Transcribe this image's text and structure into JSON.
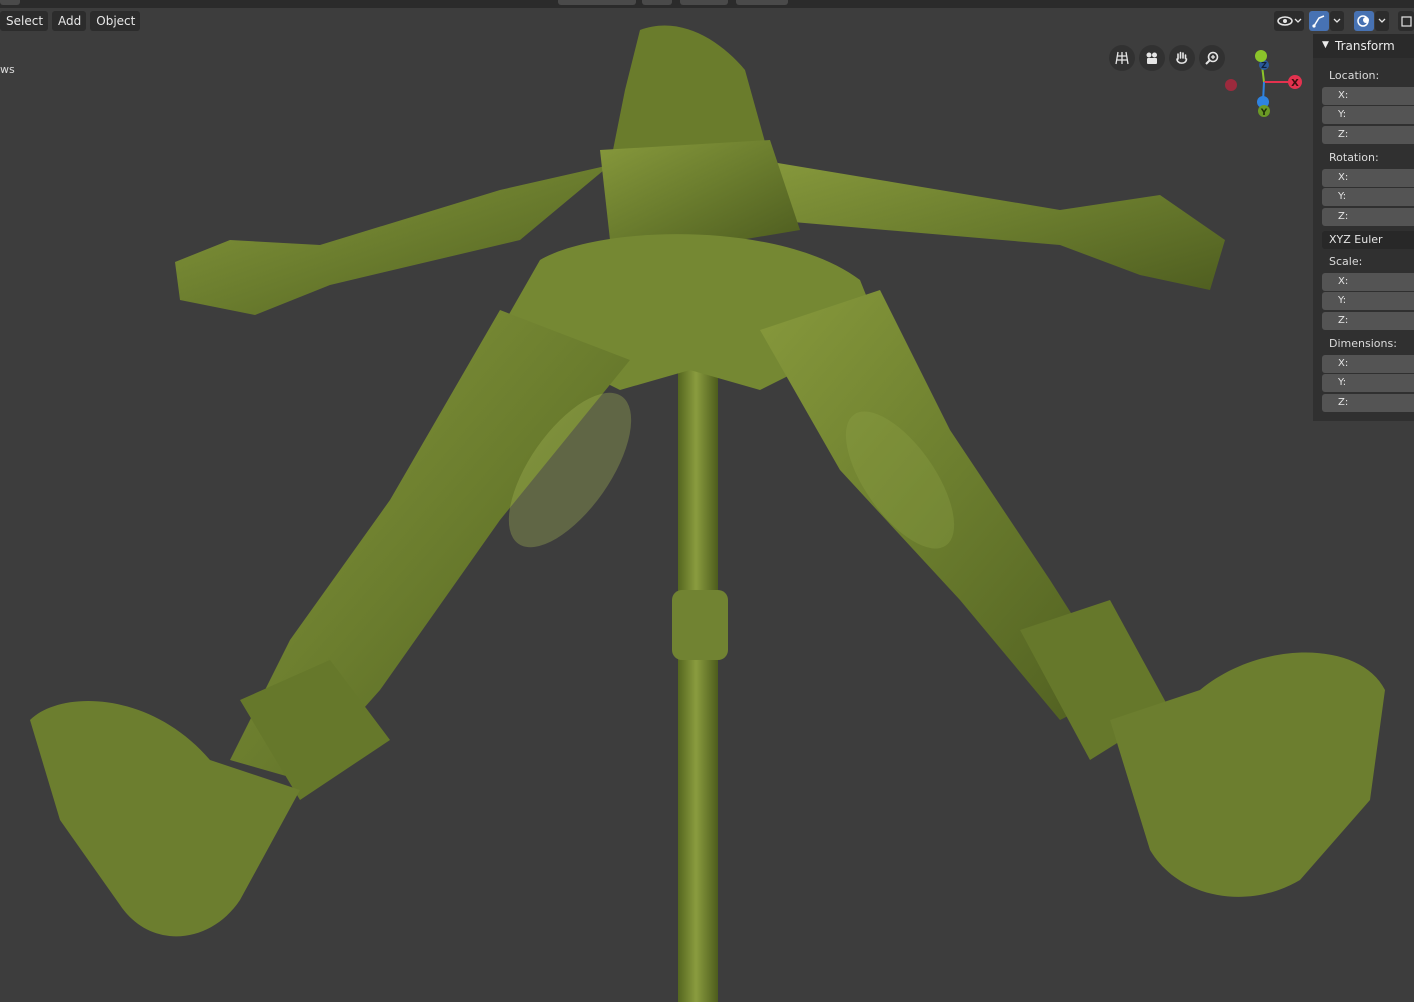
{
  "header": {
    "menu": [
      "Select",
      "Add",
      "Object"
    ],
    "partial_label": "ws"
  },
  "gizmo": {
    "x_label": "X",
    "y_label": "Y",
    "z_label": "Z"
  },
  "panel": {
    "title": "Transform",
    "location_label": "Location:",
    "rotation_label": "Rotation:",
    "rotation_mode": "XYZ Euler",
    "scale_label": "Scale:",
    "dimensions_label": "Dimensions:",
    "axis_x": "X:",
    "axis_y": "Y:",
    "axis_z": "Z:"
  },
  "colors": {
    "viewport_bg": "#3d3d3d",
    "model": "#6b7d2e",
    "active_icon": "#4772b3",
    "gizmo_x": "#e4324f",
    "gizmo_y": "#8bc42a",
    "gizmo_z": "#2f83e0"
  },
  "icons": [
    "visibility-icon",
    "gizmo-toggle-icon",
    "overlay-icon",
    "grid-icon",
    "camera-icon",
    "hand-pan-icon",
    "zoom-icon"
  ]
}
